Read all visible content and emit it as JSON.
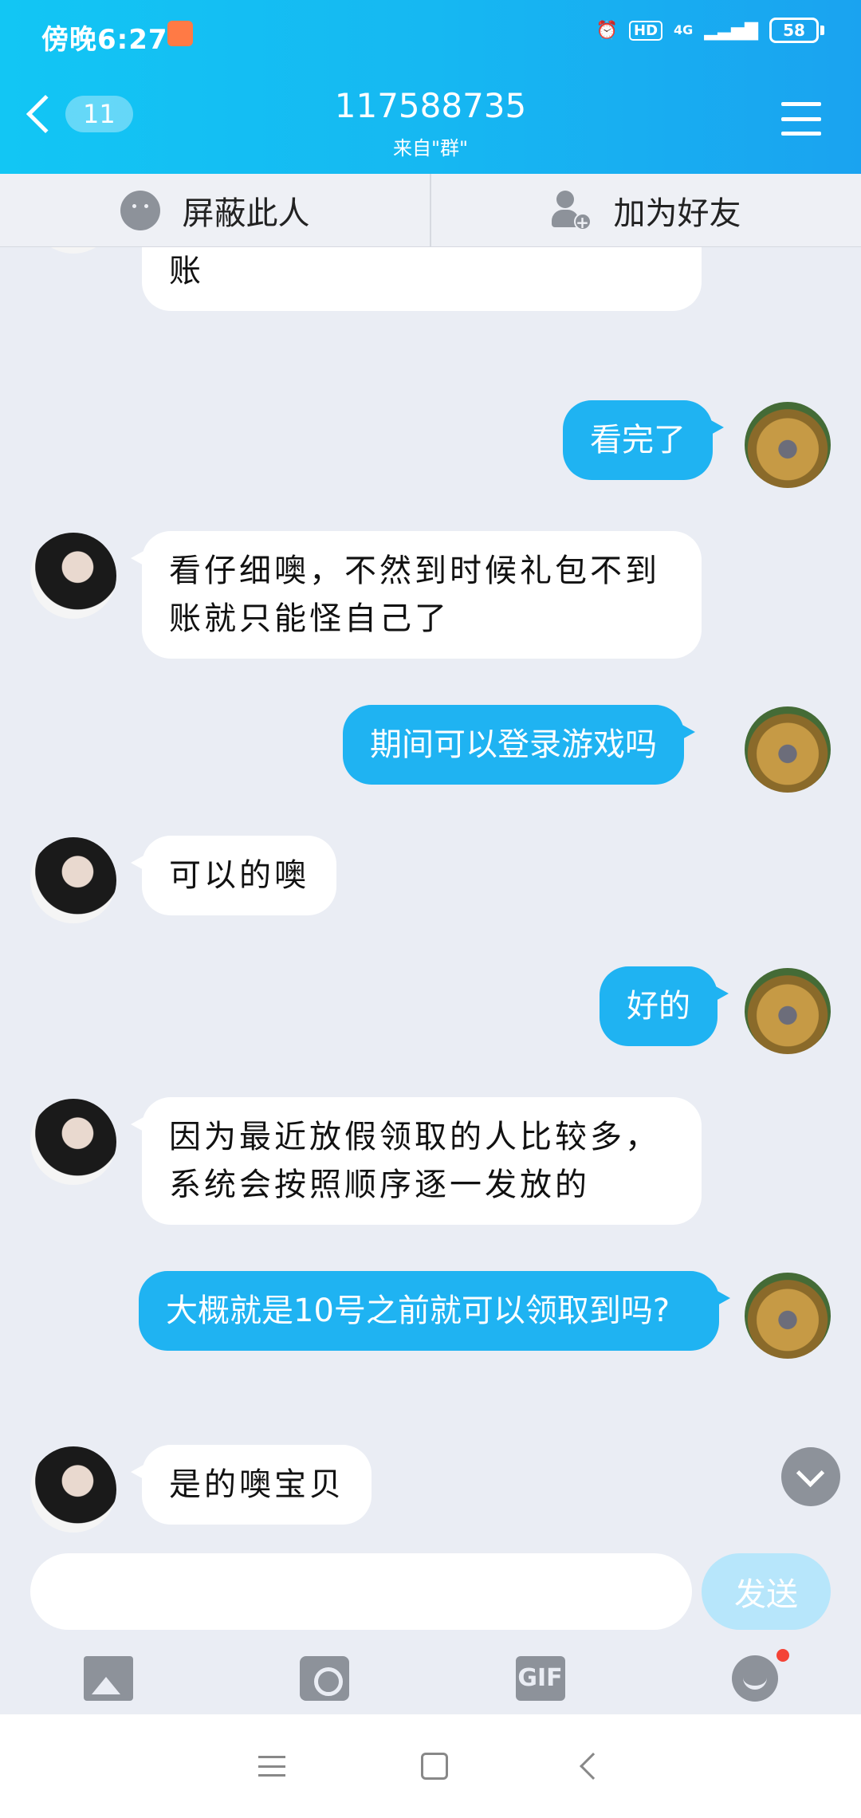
{
  "status_bar": {
    "time": "傍晚6:27",
    "hd": "HD",
    "network": "4G",
    "battery": "58"
  },
  "header": {
    "back_count": "11",
    "title": "117588735",
    "subtitle": "来自\"群\""
  },
  "actions": {
    "block_label": "屏蔽此人",
    "add_friend_label": "加为好友"
  },
  "messages": [
    {
      "direction": "in",
      "text": "噢，很重要会关系到礼包到不到账"
    },
    {
      "direction": "out",
      "text": "看完了"
    },
    {
      "direction": "in",
      "text": "看仔细噢，不然到时候礼包不到账就只能怪自己了"
    },
    {
      "direction": "out",
      "text": "期间可以登录游戏吗"
    },
    {
      "direction": "in",
      "text": "可以的噢"
    },
    {
      "direction": "out",
      "text": "好的"
    },
    {
      "direction": "in",
      "text": "因为最近放假领取的人比较多，系统会按照顺序逐一发放的"
    },
    {
      "direction": "out",
      "text": "大概就是10号之前就可以领取到吗?"
    },
    {
      "direction": "in",
      "text": "是的噢宝贝"
    }
  ],
  "input": {
    "value": "",
    "send_label": "发送"
  },
  "toolbar": {
    "gif_label": "GIF"
  },
  "colors": {
    "header_start": "#12c6f4",
    "header_end": "#1aa3f0",
    "out_bubble": "#1fb3f2",
    "in_bubble": "#ffffff",
    "background": "#eaedf4"
  },
  "icons": [
    "back-chevron-icon",
    "menu-icon",
    "block-icon",
    "add-friend-icon",
    "scroll-down-icon",
    "image-icon",
    "camera-icon",
    "gif-icon",
    "emoji-icon"
  ]
}
